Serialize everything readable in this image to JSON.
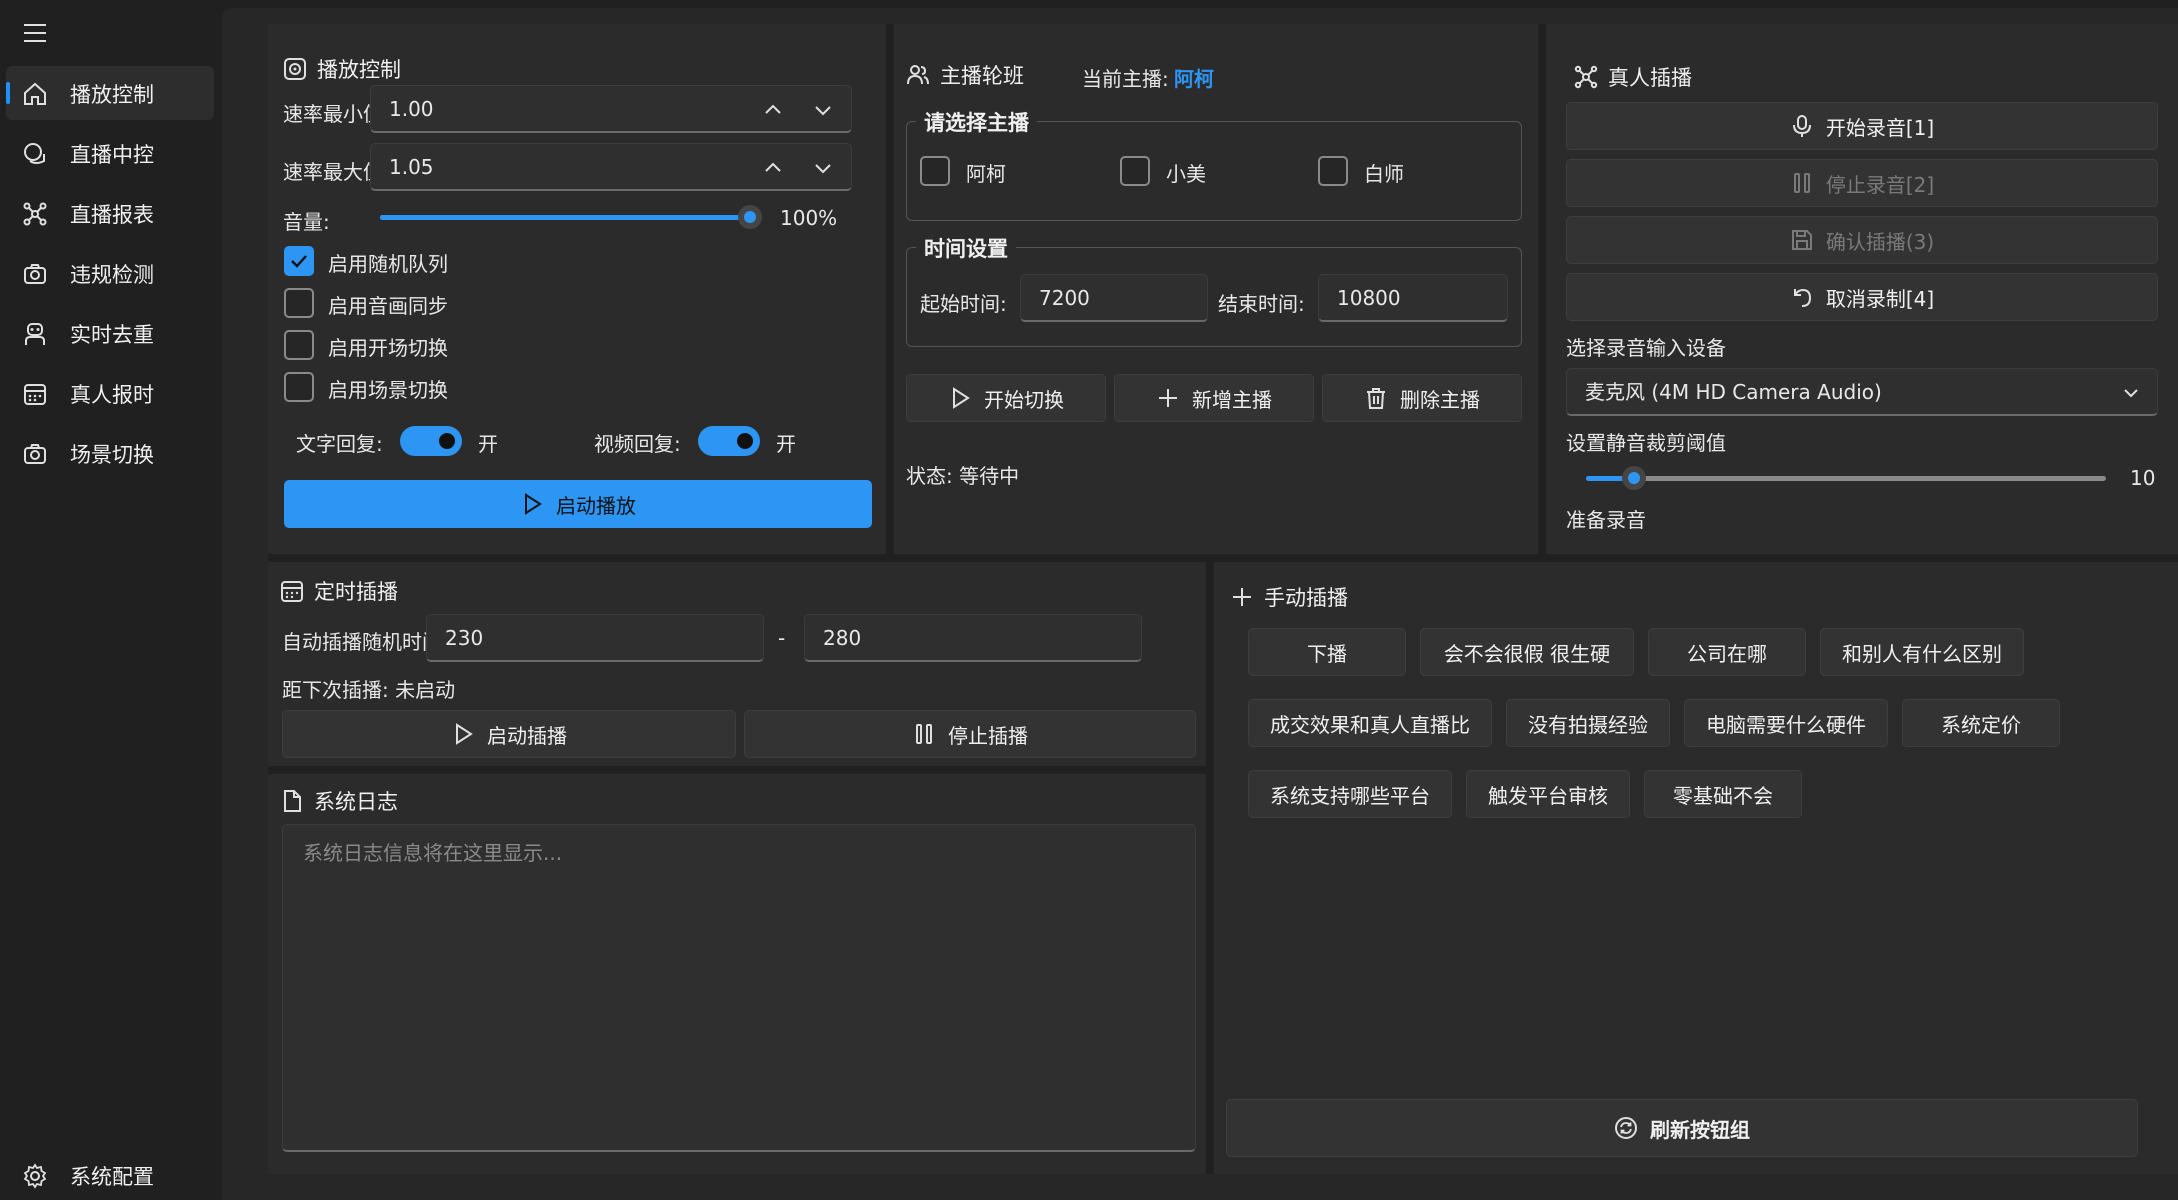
{
  "sidebar": {
    "items": [
      {
        "label": "播放控制",
        "icon": "home-icon"
      },
      {
        "label": "直播中控",
        "icon": "chat-icon"
      },
      {
        "label": "直播报表",
        "icon": "network-icon"
      },
      {
        "label": "违规检测",
        "icon": "camera-icon"
      },
      {
        "label": "实时去重",
        "icon": "robot-icon"
      },
      {
        "label": "真人报时",
        "icon": "calendar-icon"
      },
      {
        "label": "场景切换",
        "icon": "camera-icon"
      }
    ],
    "settings_label": "系统配置"
  },
  "playback": {
    "title": "播放控制",
    "rate_min_label": "速率最小值:",
    "rate_min_value": "1.00",
    "rate_max_label": "速率最大值:",
    "rate_max_value": "1.05",
    "volume_label": "音量:",
    "volume_value": "100%",
    "volume_level": 1.0,
    "checkboxes": [
      {
        "label": "启用随机队列",
        "checked": true
      },
      {
        "label": "启用音画同步",
        "checked": false
      },
      {
        "label": "启用开场切换",
        "checked": false
      },
      {
        "label": "启用场景切换",
        "checked": false
      }
    ],
    "text_reply_label": "文字回复:",
    "text_reply_state": "开",
    "video_reply_label": "视频回复:",
    "video_reply_state": "开",
    "start_button": "启动播放"
  },
  "rotation": {
    "title": "主播轮班",
    "current_label": "当前主播:",
    "current_value": "阿柯",
    "select_group": "请选择主播",
    "hosts": [
      "阿柯",
      "小美",
      "白师"
    ],
    "time_group": "时间设置",
    "start_label": "起始时间:",
    "start_value": "7200",
    "end_label": "结束时间:",
    "end_value": "10800",
    "btn_switch": "开始切换",
    "btn_add": "新增主播",
    "btn_delete": "删除主播",
    "status": "状态: 等待中"
  },
  "live_insert": {
    "title": "真人插播",
    "btn_record": "开始录音[1]",
    "btn_stop": "停止录音[2]",
    "btn_confirm": "确认插播(3)",
    "btn_cancel": "取消录制[4]",
    "device_label": "选择录音输入设备",
    "device_value": "麦克风 (4M HD Camera Audio)",
    "threshold_label": "设置静音裁剪阈值",
    "threshold_value": "10",
    "status": "准备录音"
  },
  "timed": {
    "title": "定时插播",
    "random_label": "自动插播随机时间:",
    "min_value": "230",
    "dash": "-",
    "max_value": "280",
    "next_label": "距下次插播: 未启动",
    "btn_start": "启动插播",
    "btn_stop": "停止插播"
  },
  "log": {
    "title": "系统日志",
    "placeholder": "系统日志信息将在这里显示..."
  },
  "manual": {
    "title": "手动插播",
    "chips": [
      [
        "下播",
        "会不会很假 很生硬",
        "公司在哪",
        "和别人有什么区别"
      ],
      [
        "成交效果和真人直播比",
        "没有拍摄经验",
        "电脑需要什么硬件",
        "系统定价"
      ],
      [
        "系统支持哪些平台",
        "触发平台审核",
        "零基础不会"
      ]
    ],
    "refresh_button": "刷新按钮组"
  },
  "colors": {
    "accent": "#2d95f4",
    "panel": "#2b2b2b",
    "background": "#202020"
  }
}
